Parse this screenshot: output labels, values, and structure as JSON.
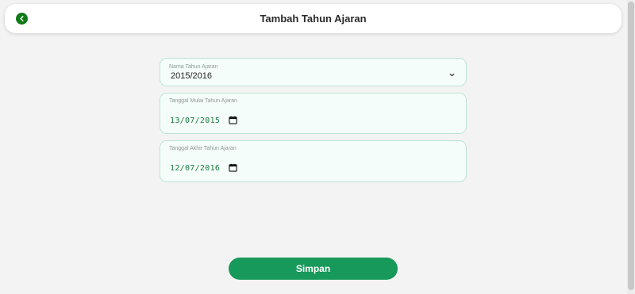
{
  "header": {
    "title": "Tambah Tahun Ajaran",
    "back_icon": "chevron-left-icon",
    "back_color": "#0f7a18"
  },
  "form": {
    "academic_year": {
      "label": "Nama Tahun Ajaran",
      "value": "2015/2016",
      "icon": "chevron-down-icon"
    },
    "start_date": {
      "label": "Tanggal Mulai Tahun Ajaran",
      "value": "13/07/2015",
      "icon": "calendar-icon"
    },
    "end_date": {
      "label": "Tanggal Akhir Tahun Ajaran",
      "value": "12/07/2016",
      "icon": "calendar-icon"
    }
  },
  "actions": {
    "save_label": "Simpan",
    "save_color": "#16995a"
  },
  "colors": {
    "page_bg": "#f3f3f3",
    "field_bg": "#f5fdfa",
    "field_border": "#bfe3d2",
    "date_text": "#1a7a3e"
  }
}
